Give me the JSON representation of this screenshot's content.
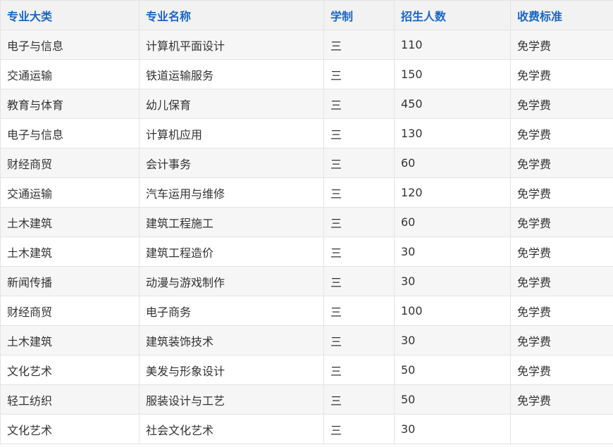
{
  "table": {
    "headers": [
      "专业大类",
      "专业名称",
      "学制",
      "招生人数",
      "收费标准"
    ],
    "rows": [
      [
        "电子与信息",
        "计算机平面设计",
        "三",
        "110",
        "免学费"
      ],
      [
        "交通运输",
        "铁道运输服务",
        "三",
        "150",
        "免学费"
      ],
      [
        "教育与体育",
        "幼儿保育",
        "三",
        "450",
        "免学费"
      ],
      [
        "电子与信息",
        "计算机应用",
        "三",
        "130",
        "免学费"
      ],
      [
        "财经商贸",
        "会计事务",
        "三",
        "60",
        "免学费"
      ],
      [
        "交通运输",
        "汽车运用与维修",
        "三",
        "120",
        "免学费"
      ],
      [
        "土木建筑",
        "建筑工程施工",
        "三",
        "60",
        "免学费"
      ],
      [
        "土木建筑",
        "建筑工程造价",
        "三",
        "30",
        "免学费"
      ],
      [
        "新闻传播",
        "动漫与游戏制作",
        "三",
        "30",
        "免学费"
      ],
      [
        "财经商贸",
        "电子商务",
        "三",
        "100",
        "免学费"
      ],
      [
        "土木建筑",
        "建筑装饰技术",
        "三",
        "30",
        "免学费"
      ],
      [
        "文化艺术",
        "美发与形象设计",
        "三",
        "50",
        "免学费"
      ],
      [
        "轻工纺织",
        "服装设计与工艺",
        "三",
        "50",
        "免学费"
      ],
      [
        "文化艺术",
        "社会文化艺术",
        "三",
        "30",
        ""
      ]
    ]
  },
  "colors": {
    "header_text": "#1a66c4",
    "header_background": "#f2f2f2",
    "body_text": "#333333",
    "border": "#e3e3e3"
  }
}
